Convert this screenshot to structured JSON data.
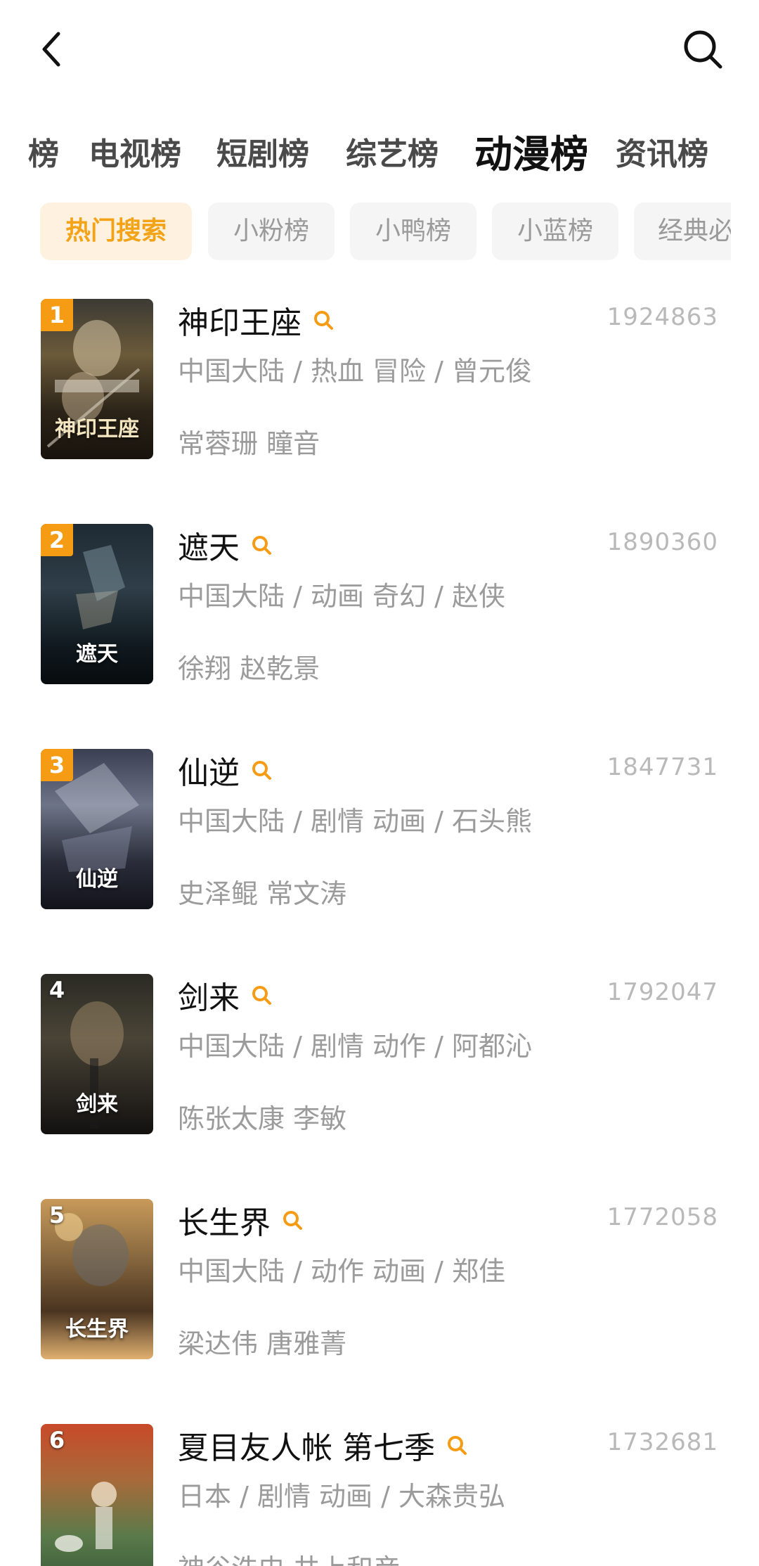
{
  "header": {
    "back_icon": "chevron-left-icon",
    "search_icon": "search-icon"
  },
  "tabs": [
    {
      "label": "榜"
    },
    {
      "label": "电视榜"
    },
    {
      "label": "短剧榜"
    },
    {
      "label": "综艺榜"
    },
    {
      "label": "动漫榜",
      "active": true
    },
    {
      "label": "资讯榜"
    }
  ],
  "subtabs": [
    {
      "label": "热门搜索",
      "active": true
    },
    {
      "label": "小粉榜"
    },
    {
      "label": "小鸭榜"
    },
    {
      "label": "小蓝榜"
    },
    {
      "label": "经典必"
    }
  ],
  "colors": {
    "accent": "#f59b14",
    "active_chip_bg": "#fff1e0",
    "active_chip_text": "#f3a318",
    "meta_text": "#9b9b9b",
    "count_text": "#b9b9b9"
  },
  "items": [
    {
      "rank": "1",
      "poster_text": "神印王座",
      "title": "神印王座",
      "count": "1924863",
      "meta": "中国大陆 / 热血 冒险 / 曾元俊",
      "cast": "常蓉珊 瞳音"
    },
    {
      "rank": "2",
      "poster_text": "遮天",
      "title": "遮天",
      "count": "1890360",
      "meta": "中国大陆 / 动画 奇幻 / 赵侠",
      "cast": "徐翔 赵乾景"
    },
    {
      "rank": "3",
      "poster_text": "仙逆",
      "title": "仙逆",
      "count": "1847731",
      "meta": "中国大陆 / 剧情 动画 / 石头熊",
      "cast": "史泽鲲   常文涛"
    },
    {
      "rank": "4",
      "poster_text": "剑来",
      "title": "剑来",
      "count": "1792047",
      "meta": "中国大陆 / 剧情 动作 / 阿都沁",
      "cast": "陈张太康 李敏"
    },
    {
      "rank": "5",
      "poster_text": "长生界",
      "title": "长生界",
      "count": "1772058",
      "meta": "中国大陆 / 动作 动画 / 郑佳",
      "cast": "梁达伟 唐雅菁"
    },
    {
      "rank": "6",
      "poster_text": "",
      "title": "夏目友人帐 第七季",
      "count": "1732681",
      "meta": "日本 / 剧情 动画 / 大森贵弘",
      "cast": "神谷浩史 井上和彦"
    }
  ]
}
